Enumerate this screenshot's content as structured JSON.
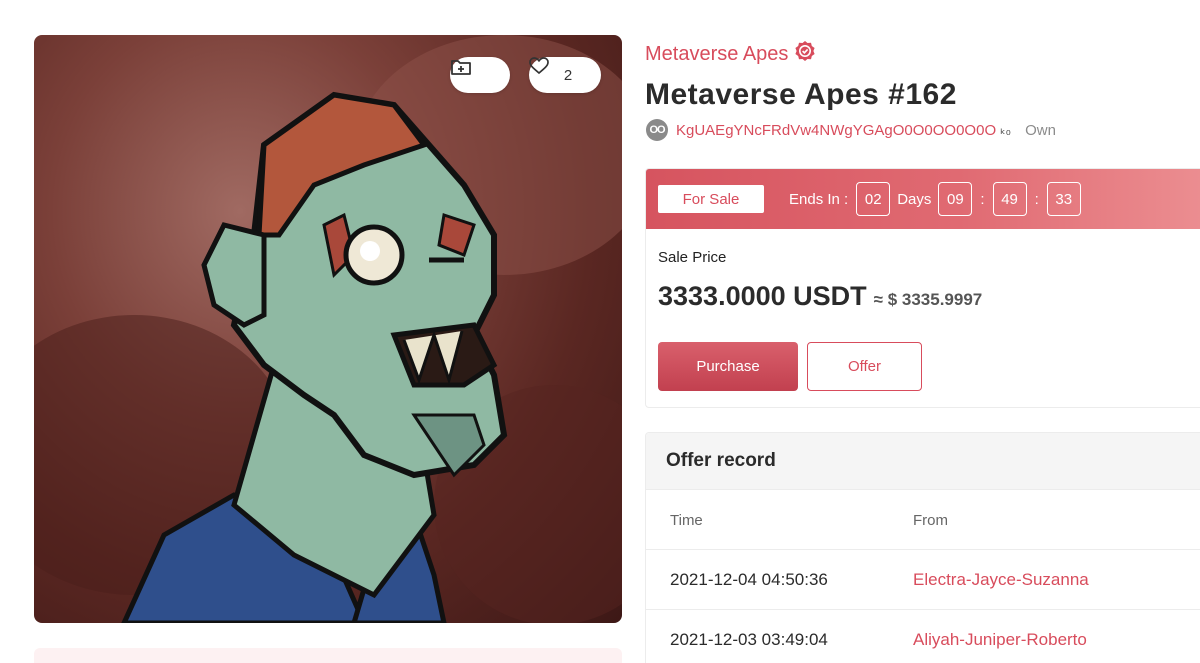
{
  "artwork": {
    "like_count": "2",
    "folder_icon": "folder-plus-icon",
    "like_icon": "heart-icon"
  },
  "collection": {
    "name": "Metaverse Apes",
    "verified_icon": "verified-badge-icon"
  },
  "item": {
    "title": "Metaverse Apes #162"
  },
  "owner": {
    "avatar_text": "OO",
    "address": "KgUAEgYNcFRdVw4NWgYGAgO0O0OO0O0O",
    "suffix": "ₖ₀",
    "own_label": "Own"
  },
  "sale": {
    "status_label": "For Sale",
    "ends_in_label": "Ends In :",
    "days": "02",
    "days_label": "Days",
    "hours": "09",
    "minutes": "49",
    "seconds": "33",
    "colon": ":",
    "price_label": "Sale Price",
    "price": "3333.0000 USDT",
    "price_usd": "≈ $ 3335.9997",
    "purchase_label": "Purchase",
    "offer_label": "Offer"
  },
  "offers": {
    "title": "Offer record",
    "columns": [
      "Time",
      "From"
    ],
    "rows": [
      {
        "time": "2021-12-04 04:50:36",
        "from": "Electra-Jayce-Suzanna"
      },
      {
        "time": "2021-12-03 03:49:04",
        "from": "Aliyah-Juniper-Roberto"
      }
    ]
  },
  "colors": {
    "accent": "#d84c5c",
    "sale_bar_start": "#d6545f",
    "sale_bar_end": "#ec8f92"
  }
}
